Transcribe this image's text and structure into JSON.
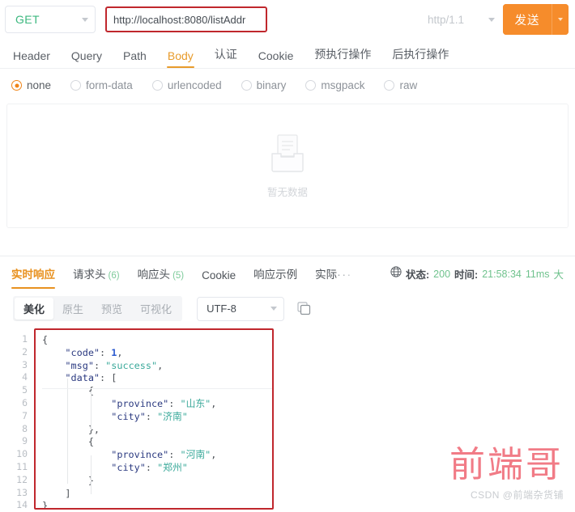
{
  "request_bar": {
    "method": "GET",
    "url_value": "http://localhost:8080/listAddr",
    "protocol": "http/1.1",
    "send_label": "发送"
  },
  "request_tabs": [
    {
      "label": "Header",
      "active": false
    },
    {
      "label": "Query",
      "active": false
    },
    {
      "label": "Path",
      "active": false
    },
    {
      "label": "Body",
      "active": true
    },
    {
      "label": "认证",
      "active": false
    },
    {
      "label": "Cookie",
      "active": false
    },
    {
      "label": "预执行操作",
      "active": false
    },
    {
      "label": "后执行操作",
      "active": false
    }
  ],
  "body_types": [
    {
      "label": "none",
      "selected": true
    },
    {
      "label": "form-data",
      "selected": false
    },
    {
      "label": "urlencoded",
      "selected": false
    },
    {
      "label": "binary",
      "selected": false
    },
    {
      "label": "msgpack",
      "selected": false
    },
    {
      "label": "raw",
      "selected": false
    }
  ],
  "empty_state": {
    "label": "暂无数据",
    "icon": "inbox-icon"
  },
  "response_tabs": [
    {
      "label": "实时响应",
      "count": "",
      "active": true
    },
    {
      "label": "请求头",
      "count": "(6)",
      "active": false
    },
    {
      "label": "响应头",
      "count": "(5)",
      "active": false
    },
    {
      "label": "Cookie",
      "count": "",
      "active": false
    },
    {
      "label": "响应示例",
      "count": "",
      "active": false
    },
    {
      "label": "实际",
      "count": "",
      "active": false
    }
  ],
  "response_overflow": "···",
  "status": {
    "status_label": "状态:",
    "status_value": "200",
    "time_label": "时间:",
    "time_value": "21:58:34",
    "duration_value": "11ms",
    "truncated": "大"
  },
  "response_toolbar": {
    "segments": [
      {
        "label": "美化",
        "active": true
      },
      {
        "label": "原生",
        "active": false
      },
      {
        "label": "预览",
        "active": false
      },
      {
        "label": "可视化",
        "active": false
      }
    ],
    "encoding": "UTF-8",
    "copy_icon": "copy-icon"
  },
  "code_viewer": {
    "line_numbers": [
      "1",
      "2",
      "3",
      "4",
      "5",
      "6",
      "7",
      "8",
      "9",
      "10",
      "11",
      "12",
      "13",
      "14"
    ],
    "lines": [
      [
        {
          "t": "{",
          "c": "p"
        }
      ],
      [
        {
          "t": "    ",
          "c": "p"
        },
        {
          "t": "\"code\"",
          "c": "k"
        },
        {
          "t": ": ",
          "c": "p"
        },
        {
          "t": "1",
          "c": "n"
        },
        {
          "t": ",",
          "c": "p"
        }
      ],
      [
        {
          "t": "    ",
          "c": "p"
        },
        {
          "t": "\"msg\"",
          "c": "k"
        },
        {
          "t": ": ",
          "c": "p"
        },
        {
          "t": "\"success\"",
          "c": "s"
        },
        {
          "t": ",",
          "c": "p"
        }
      ],
      [
        {
          "t": "    ",
          "c": "p"
        },
        {
          "t": "\"data\"",
          "c": "k"
        },
        {
          "t": ": [",
          "c": "p"
        }
      ],
      [
        {
          "t": "        {",
          "c": "p"
        }
      ],
      [
        {
          "t": "            ",
          "c": "p"
        },
        {
          "t": "\"province\"",
          "c": "k"
        },
        {
          "t": ": ",
          "c": "p"
        },
        {
          "t": "\"山东\"",
          "c": "s"
        },
        {
          "t": ",",
          "c": "p"
        }
      ],
      [
        {
          "t": "            ",
          "c": "p"
        },
        {
          "t": "\"city\"",
          "c": "k"
        },
        {
          "t": ": ",
          "c": "p"
        },
        {
          "t": "\"济南\"",
          "c": "s"
        }
      ],
      [
        {
          "t": "        },",
          "c": "p"
        }
      ],
      [
        {
          "t": "        {",
          "c": "p"
        }
      ],
      [
        {
          "t": "            ",
          "c": "p"
        },
        {
          "t": "\"province\"",
          "c": "k"
        },
        {
          "t": ": ",
          "c": "p"
        },
        {
          "t": "\"河南\"",
          "c": "s"
        },
        {
          "t": ",",
          "c": "p"
        }
      ],
      [
        {
          "t": "            ",
          "c": "p"
        },
        {
          "t": "\"city\"",
          "c": "k"
        },
        {
          "t": ": ",
          "c": "p"
        },
        {
          "t": "\"郑州\"",
          "c": "s"
        }
      ],
      [
        {
          "t": "        }",
          "c": "p"
        }
      ],
      [
        {
          "t": "    ]",
          "c": "p"
        }
      ],
      [
        {
          "t": "}",
          "c": "p"
        }
      ]
    ]
  },
  "watermark": {
    "main": "前端哥",
    "sub": "CSDN @前端杂货铺"
  },
  "colors": {
    "accent_orange": "#f68c2b",
    "tab_active": "#e8911f",
    "method_green": "#3bb77e",
    "annotation_red": "#c0272d",
    "status_green": "#6fc28d",
    "json_key": "#2b3a80",
    "json_string": "#3aa99a",
    "json_number": "#2b5ad0",
    "watermark_red": "#f0707c"
  }
}
